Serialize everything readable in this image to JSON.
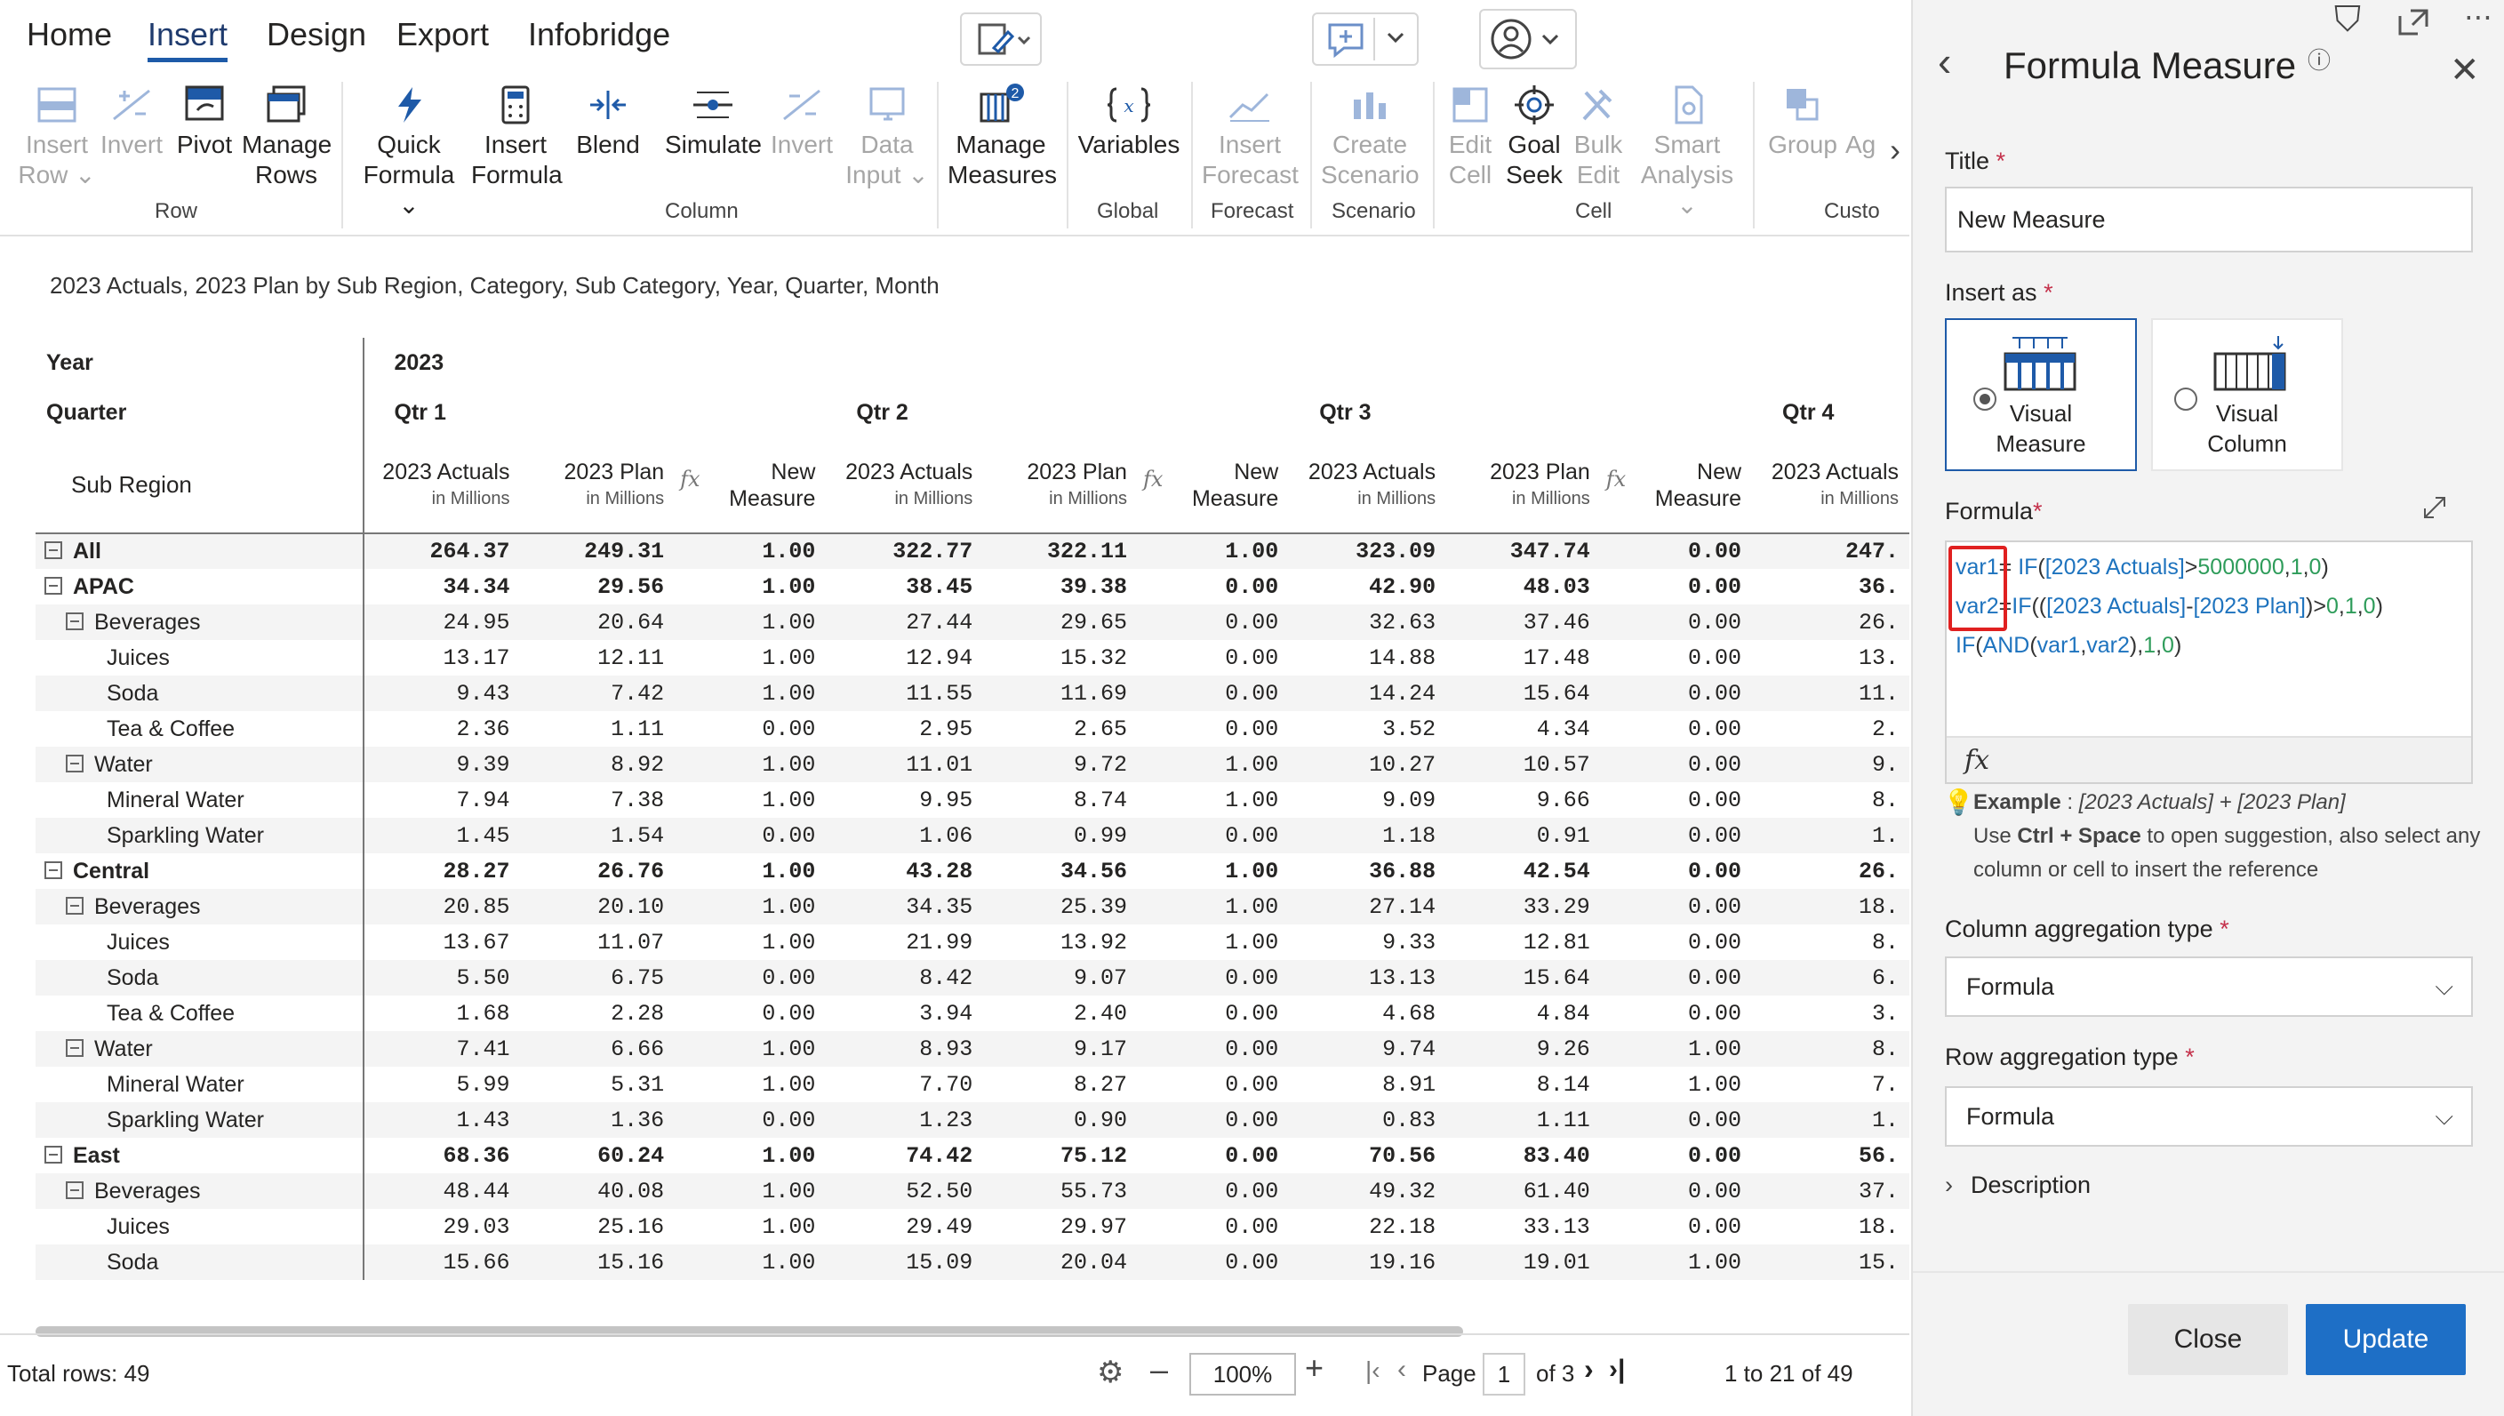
{
  "menu": {
    "tabs": [
      "Home",
      "Insert",
      "Design",
      "Export",
      "Infobridge"
    ],
    "active": "Insert"
  },
  "ribbon": {
    "buttons": [
      {
        "label": "Insert\nRow",
        "disabled": true,
        "dropdown": true
      },
      {
        "label": "Invert",
        "disabled": true
      },
      {
        "label": "Pivot",
        "disabled": false
      },
      {
        "label": "Manage\nRows",
        "disabled": false
      },
      {
        "label": "Quick\nFormula",
        "disabled": false,
        "dropdown": true
      },
      {
        "label": "Insert\nFormula",
        "disabled": false
      },
      {
        "label": "Blend",
        "disabled": false
      },
      {
        "label": "Simulate",
        "disabled": false
      },
      {
        "label": "Invert",
        "disabled": true
      },
      {
        "label": "Data\nInput",
        "disabled": true,
        "dropdown": true
      },
      {
        "label": "Manage\nMeasures",
        "disabled": false,
        "badge": "2"
      },
      {
        "label": "Variables",
        "disabled": false
      },
      {
        "label": "Insert\nForecast",
        "disabled": true
      },
      {
        "label": "Create\nScenario",
        "disabled": true
      },
      {
        "label": "Edit\nCell",
        "disabled": true
      },
      {
        "label": "Goal\nSeek",
        "disabled": false
      },
      {
        "label": "Bulk\nEdit",
        "disabled": true
      },
      {
        "label": "Smart\nAnalysis",
        "disabled": true,
        "dropdown": true
      },
      {
        "label": "Group",
        "disabled": true
      },
      {
        "label": "Ag",
        "disabled": true
      }
    ],
    "groups": [
      "Row",
      "Column",
      "Global",
      "Forecast",
      "Scenario",
      "Cell",
      "Custo"
    ]
  },
  "report": {
    "subtitle": "2023 Actuals, 2023 Plan by Sub Region, Category, Sub Category, Year, Quarter, Month",
    "year_label": "Year",
    "quarter_label": "Quarter",
    "subregion_label": "Sub Region",
    "year": "2023",
    "quarters": [
      "Qtr 1",
      "Qtr 2",
      "Qtr 3",
      "Qtr 4"
    ],
    "columns": [
      {
        "title": "2023 Actuals",
        "unit": "in Millions"
      },
      {
        "title": "2023 Plan",
        "unit": "in Millions"
      },
      {
        "title": "New\nMeasure",
        "unit": ""
      }
    ],
    "rows": [
      {
        "level": 0,
        "expand": true,
        "label": "All",
        "bold": true,
        "values": [
          "264.37",
          "249.31",
          "1.00",
          "322.77",
          "322.11",
          "1.00",
          "323.09",
          "347.74",
          "0.00",
          "247."
        ]
      },
      {
        "level": 0,
        "expand": true,
        "label": "APAC",
        "bold": true,
        "values": [
          "34.34",
          "29.56",
          "1.00",
          "38.45",
          "39.38",
          "0.00",
          "42.90",
          "48.03",
          "0.00",
          "36."
        ]
      },
      {
        "level": 1,
        "expand": true,
        "label": "Beverages",
        "bold": false,
        "values": [
          "24.95",
          "20.64",
          "1.00",
          "27.44",
          "29.65",
          "0.00",
          "32.63",
          "37.46",
          "0.00",
          "26."
        ]
      },
      {
        "level": 2,
        "expand": false,
        "label": "Juices",
        "bold": false,
        "values": [
          "13.17",
          "12.11",
          "1.00",
          "12.94",
          "15.32",
          "0.00",
          "14.88",
          "17.48",
          "0.00",
          "13."
        ]
      },
      {
        "level": 2,
        "expand": false,
        "label": "Soda",
        "bold": false,
        "values": [
          "9.43",
          "7.42",
          "1.00",
          "11.55",
          "11.69",
          "0.00",
          "14.24",
          "15.64",
          "0.00",
          "11."
        ]
      },
      {
        "level": 2,
        "expand": false,
        "label": "Tea & Coffee",
        "bold": false,
        "values": [
          "2.36",
          "1.11",
          "0.00",
          "2.95",
          "2.65",
          "0.00",
          "3.52",
          "4.34",
          "0.00",
          "2."
        ]
      },
      {
        "level": 1,
        "expand": true,
        "label": "Water",
        "bold": false,
        "values": [
          "9.39",
          "8.92",
          "1.00",
          "11.01",
          "9.72",
          "1.00",
          "10.27",
          "10.57",
          "0.00",
          "9."
        ]
      },
      {
        "level": 2,
        "expand": false,
        "label": "Mineral Water",
        "bold": false,
        "values": [
          "7.94",
          "7.38",
          "1.00",
          "9.95",
          "8.74",
          "1.00",
          "9.09",
          "9.66",
          "0.00",
          "8."
        ]
      },
      {
        "level": 2,
        "expand": false,
        "label": "Sparkling Water",
        "bold": false,
        "values": [
          "1.45",
          "1.54",
          "0.00",
          "1.06",
          "0.99",
          "0.00",
          "1.18",
          "0.91",
          "0.00",
          "1."
        ]
      },
      {
        "level": 0,
        "expand": true,
        "label": "Central",
        "bold": true,
        "values": [
          "28.27",
          "26.76",
          "1.00",
          "43.28",
          "34.56",
          "1.00",
          "36.88",
          "42.54",
          "0.00",
          "26."
        ]
      },
      {
        "level": 1,
        "expand": true,
        "label": "Beverages",
        "bold": false,
        "values": [
          "20.85",
          "20.10",
          "1.00",
          "34.35",
          "25.39",
          "1.00",
          "27.14",
          "33.29",
          "0.00",
          "18."
        ]
      },
      {
        "level": 2,
        "expand": false,
        "label": "Juices",
        "bold": false,
        "values": [
          "13.67",
          "11.07",
          "1.00",
          "21.99",
          "13.92",
          "1.00",
          "9.33",
          "12.81",
          "0.00",
          "8."
        ]
      },
      {
        "level": 2,
        "expand": false,
        "label": "Soda",
        "bold": false,
        "values": [
          "5.50",
          "6.75",
          "0.00",
          "8.42",
          "9.07",
          "0.00",
          "13.13",
          "15.64",
          "0.00",
          "6."
        ]
      },
      {
        "level": 2,
        "expand": false,
        "label": "Tea & Coffee",
        "bold": false,
        "values": [
          "1.68",
          "2.28",
          "0.00",
          "3.94",
          "2.40",
          "0.00",
          "4.68",
          "4.84",
          "0.00",
          "3."
        ]
      },
      {
        "level": 1,
        "expand": true,
        "label": "Water",
        "bold": false,
        "values": [
          "7.41",
          "6.66",
          "1.00",
          "8.93",
          "9.17",
          "0.00",
          "9.74",
          "9.26",
          "1.00",
          "8."
        ]
      },
      {
        "level": 2,
        "expand": false,
        "label": "Mineral Water",
        "bold": false,
        "values": [
          "5.99",
          "5.31",
          "1.00",
          "7.70",
          "8.27",
          "0.00",
          "8.91",
          "8.14",
          "1.00",
          "7."
        ]
      },
      {
        "level": 2,
        "expand": false,
        "label": "Sparkling Water",
        "bold": false,
        "values": [
          "1.43",
          "1.36",
          "0.00",
          "1.23",
          "0.90",
          "0.00",
          "0.83",
          "1.11",
          "0.00",
          "1."
        ]
      },
      {
        "level": 0,
        "expand": true,
        "label": "East",
        "bold": true,
        "values": [
          "68.36",
          "60.24",
          "1.00",
          "74.42",
          "75.12",
          "0.00",
          "70.56",
          "83.40",
          "0.00",
          "56."
        ]
      },
      {
        "level": 1,
        "expand": true,
        "label": "Beverages",
        "bold": false,
        "values": [
          "48.44",
          "40.08",
          "1.00",
          "52.50",
          "55.73",
          "0.00",
          "49.32",
          "61.40",
          "0.00",
          "37."
        ]
      },
      {
        "level": 2,
        "expand": false,
        "label": "Juices",
        "bold": false,
        "values": [
          "29.03",
          "25.16",
          "1.00",
          "29.49",
          "29.97",
          "0.00",
          "22.18",
          "33.13",
          "0.00",
          "18."
        ]
      },
      {
        "level": 2,
        "expand": false,
        "label": "Soda",
        "bold": false,
        "values": [
          "15.66",
          "15.16",
          "1.00",
          "15.09",
          "20.04",
          "0.00",
          "19.16",
          "19.01",
          "1.00",
          "15."
        ]
      }
    ]
  },
  "status": {
    "total_rows": "Total rows: 49",
    "zoom": "100%",
    "page_label": "Page",
    "page_value": "1",
    "page_of": "of 3",
    "range": "1 to 21 of 49"
  },
  "panel": {
    "title": "Formula Measure",
    "title_label": "Title",
    "title_value": "New Measure",
    "insert_as_label": "Insert as",
    "insert_options": [
      "Visual\nMeasure",
      "Visual\nColumn"
    ],
    "formula_label": "Formula",
    "formula_lines": [
      [
        [
          "var1",
          "k"
        ],
        [
          "= ",
          "p"
        ],
        [
          "IF",
          "k"
        ],
        [
          "(",
          "p"
        ],
        [
          "[2023 Actuals]",
          "k"
        ],
        [
          ">",
          "p"
        ],
        [
          "5000000",
          "g"
        ],
        [
          ",",
          "p"
        ],
        [
          "1",
          "g"
        ],
        [
          ",",
          "p"
        ],
        [
          "0",
          "g"
        ],
        [
          ")",
          "p"
        ]
      ],
      [
        [
          "var2",
          "k"
        ],
        [
          "=",
          "p"
        ],
        [
          "IF",
          "k"
        ],
        [
          "((",
          "p"
        ],
        [
          "[2023 Actuals]",
          "k"
        ],
        [
          "-",
          "p"
        ],
        [
          "[2023 Plan]",
          "k"
        ],
        [
          ")>",
          "p"
        ],
        [
          "0",
          "g"
        ],
        [
          ",",
          "p"
        ],
        [
          "1",
          "g"
        ],
        [
          ",",
          "p"
        ],
        [
          "0",
          "g"
        ],
        [
          ")",
          "p"
        ]
      ],
      [
        [
          "IF",
          "k"
        ],
        [
          "(",
          "p"
        ],
        [
          "AND",
          "k"
        ],
        [
          "(",
          "p"
        ],
        [
          "var1",
          "k"
        ],
        [
          ",",
          "p"
        ],
        [
          "var2",
          "k"
        ],
        [
          "),",
          "p"
        ],
        [
          "1",
          "g"
        ],
        [
          ",",
          "p"
        ],
        [
          "0",
          "g"
        ],
        [
          ")",
          "p"
        ]
      ]
    ],
    "fx_label": "fx",
    "example_label": "Example",
    "example_value": "[2023 Actuals] + [2023 Plan]",
    "hint_prefix": "Use ",
    "hint_keys": "Ctrl + Space",
    "hint_rest": " to open suggestion, also select any",
    "hint_line2": "column or cell to insert the reference",
    "col_agg_label": "Column aggregation type",
    "col_agg_value": "Formula",
    "row_agg_label": "Row aggregation type",
    "row_agg_value": "Formula",
    "description_label": "Description",
    "close_label": "Close",
    "update_label": "Update"
  },
  "colors": {
    "accent": "#1e5aa8",
    "highlight": "#e02020",
    "keyword": "#1e73be",
    "number": "#2e9c5a"
  }
}
